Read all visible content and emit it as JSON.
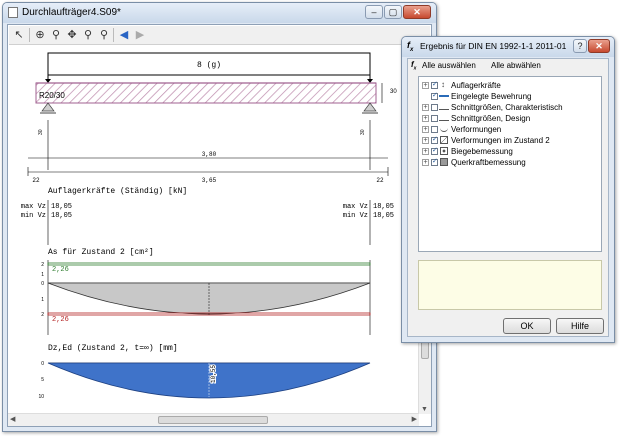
{
  "main_window": {
    "title": "Durchlaufträger4.S09*",
    "controls": {
      "minimize": "–",
      "maximize": "▢",
      "close": "✕"
    },
    "toolbar_icons": [
      "select-arrow-icon",
      "zoom-all-icon",
      "zoom-in-icon",
      "pan-icon",
      "zoom-window-icon",
      "zoom-out-icon",
      "back-icon",
      "forward-icon"
    ]
  },
  "drawing": {
    "load_label": "8 (g)",
    "section_label": "R20/30",
    "height_label": "30",
    "support_left_label": "30",
    "support_right_label": "30",
    "span_inner": "3,80",
    "span_outer": "3,65",
    "edge_left": "22",
    "edge_right": "22"
  },
  "support_forces": {
    "title": "Auflagerkräfte (Ständig) [kN]",
    "left_rows": [
      {
        "label": "max Vz",
        "value": "18,05"
      },
      {
        "label": "min Vz",
        "value": "18,05"
      }
    ],
    "right_rows": [
      {
        "label": "max Vz",
        "value": "18,05"
      },
      {
        "label": "min Vz",
        "value": "18,05"
      }
    ]
  },
  "reinforcement": {
    "title": "As für Zustand 2 [cm²]",
    "top_value": "2,26",
    "bottom_value": "2,26",
    "axis_ticks": [
      "2",
      "1",
      "0",
      "1",
      "2"
    ],
    "colors": {
      "top": "#2e7d2e",
      "bottom": "#b32020",
      "fill": "#c8c8c8"
    }
  },
  "deflection": {
    "title": "Dz,Ed (Zustand 2, t=∞) [mm]",
    "axis_ticks": [
      "0",
      "5",
      "10"
    ],
    "max_value": "10,55",
    "colors": {
      "fill": "#3f73c9"
    }
  },
  "dialog": {
    "title": "Ergebnis für DIN EN 1992-1-1 2011-01",
    "controls": {
      "help": "?",
      "close": "✕"
    },
    "fx_icon": "fx-icon",
    "select_all": "Alle auswählen",
    "deselect_all": "Alle abwählen",
    "tree": [
      {
        "label": "Auflagerkräfte",
        "checked": true,
        "expandable": true
      },
      {
        "label": "Eingelegte Bewehrung",
        "checked": true,
        "expandable": false
      },
      {
        "label": "Schnittgrößen, Charakteristisch",
        "checked": false,
        "expandable": true
      },
      {
        "label": "Schnittgrößen, Design",
        "checked": false,
        "expandable": true
      },
      {
        "label": "Verformungen",
        "checked": false,
        "expandable": true
      },
      {
        "label": "Verformungen im Zustand 2",
        "checked": true,
        "expandable": true
      },
      {
        "label": "Biegebemessung",
        "checked": true,
        "expandable": true
      },
      {
        "label": "Querkraftbemessung",
        "checked": true,
        "expandable": true
      }
    ],
    "ok_label": "OK",
    "help_label": "Hilfe",
    "info_panel_color": "#fdfde6"
  }
}
